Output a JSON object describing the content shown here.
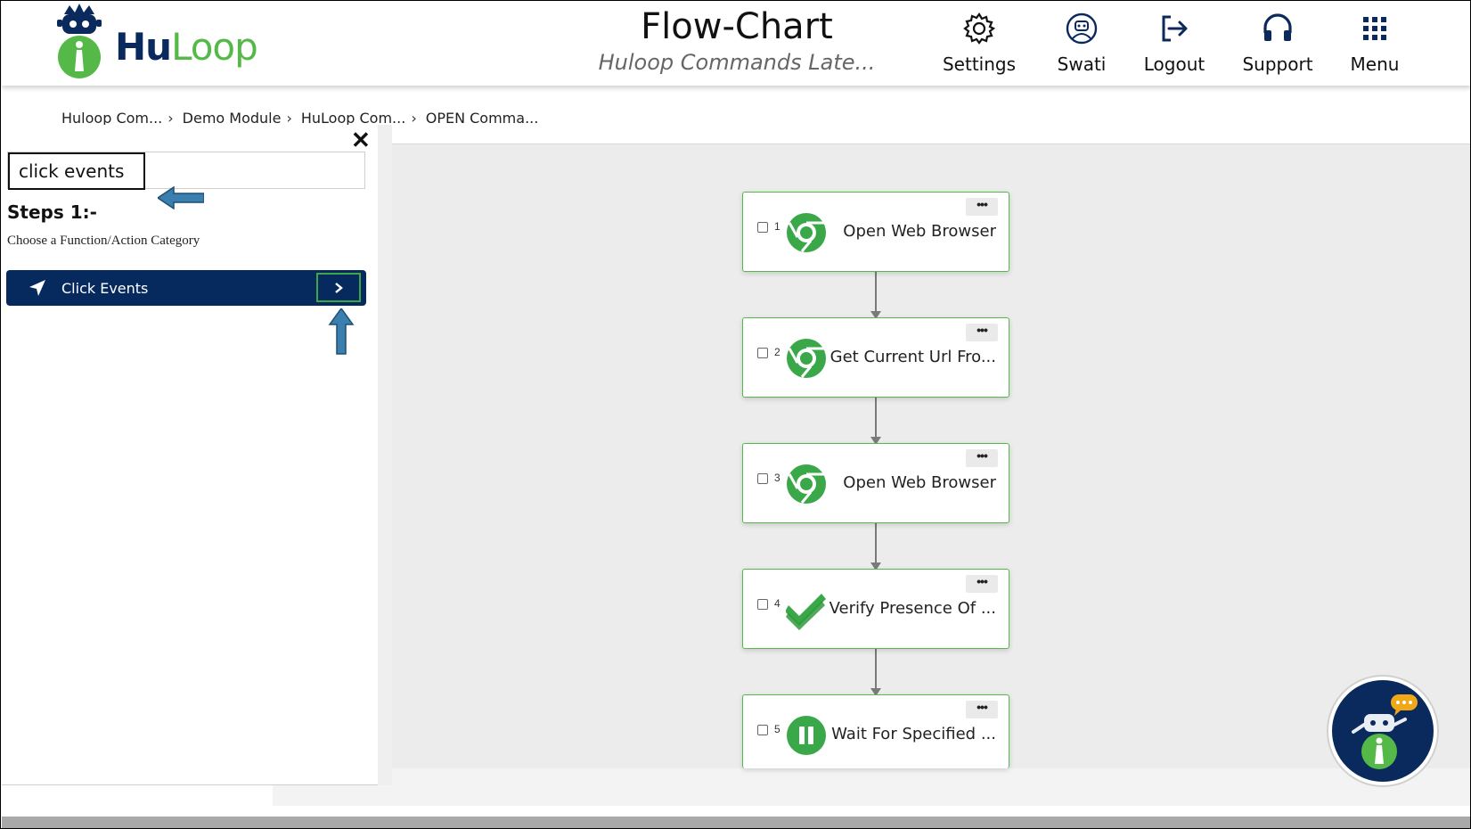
{
  "header": {
    "logo": {
      "text_hu": "Hu",
      "text_loop": "Loop"
    },
    "title": "Flow-Chart",
    "subtitle": "Huloop Commands Late...",
    "nav": [
      {
        "label": "Settings",
        "icon": "gear-icon"
      },
      {
        "label": "Swati",
        "icon": "user-robot-icon"
      },
      {
        "label": "Logout",
        "icon": "logout-icon"
      },
      {
        "label": "Support",
        "icon": "headset-icon"
      },
      {
        "label": "Menu",
        "icon": "grid-icon"
      }
    ]
  },
  "breadcrumb": [
    "Huloop Com...",
    "Demo Module",
    "HuLoop Com...",
    "OPEN Comma..."
  ],
  "panel": {
    "close_label": "✕",
    "search_value": "click events",
    "steps_title": "Steps 1:-",
    "steps_desc": "Choose a Function/Action Category",
    "category": {
      "label": "Click Events",
      "icon": "location-arrow-icon",
      "expand_icon": "chevron-right-icon"
    }
  },
  "flow": {
    "nodes": [
      {
        "number": "1",
        "label": "Open Web Browser",
        "icon": "chrome-icon"
      },
      {
        "number": "2",
        "label": "Get Current Url Fro...",
        "icon": "chrome-icon"
      },
      {
        "number": "3",
        "label": "Open Web Browser",
        "icon": "chrome-icon"
      },
      {
        "number": "4",
        "label": "Verify Presence Of ...",
        "icon": "checkmark-icon"
      },
      {
        "number": "5",
        "label": "Wait For Specified ...",
        "icon": "pause-icon"
      }
    ],
    "more_label": "•••"
  },
  "colors": {
    "brand_navy": "#062a5e",
    "brand_green": "#55b948",
    "arrow_blue": "#3a7fae"
  }
}
